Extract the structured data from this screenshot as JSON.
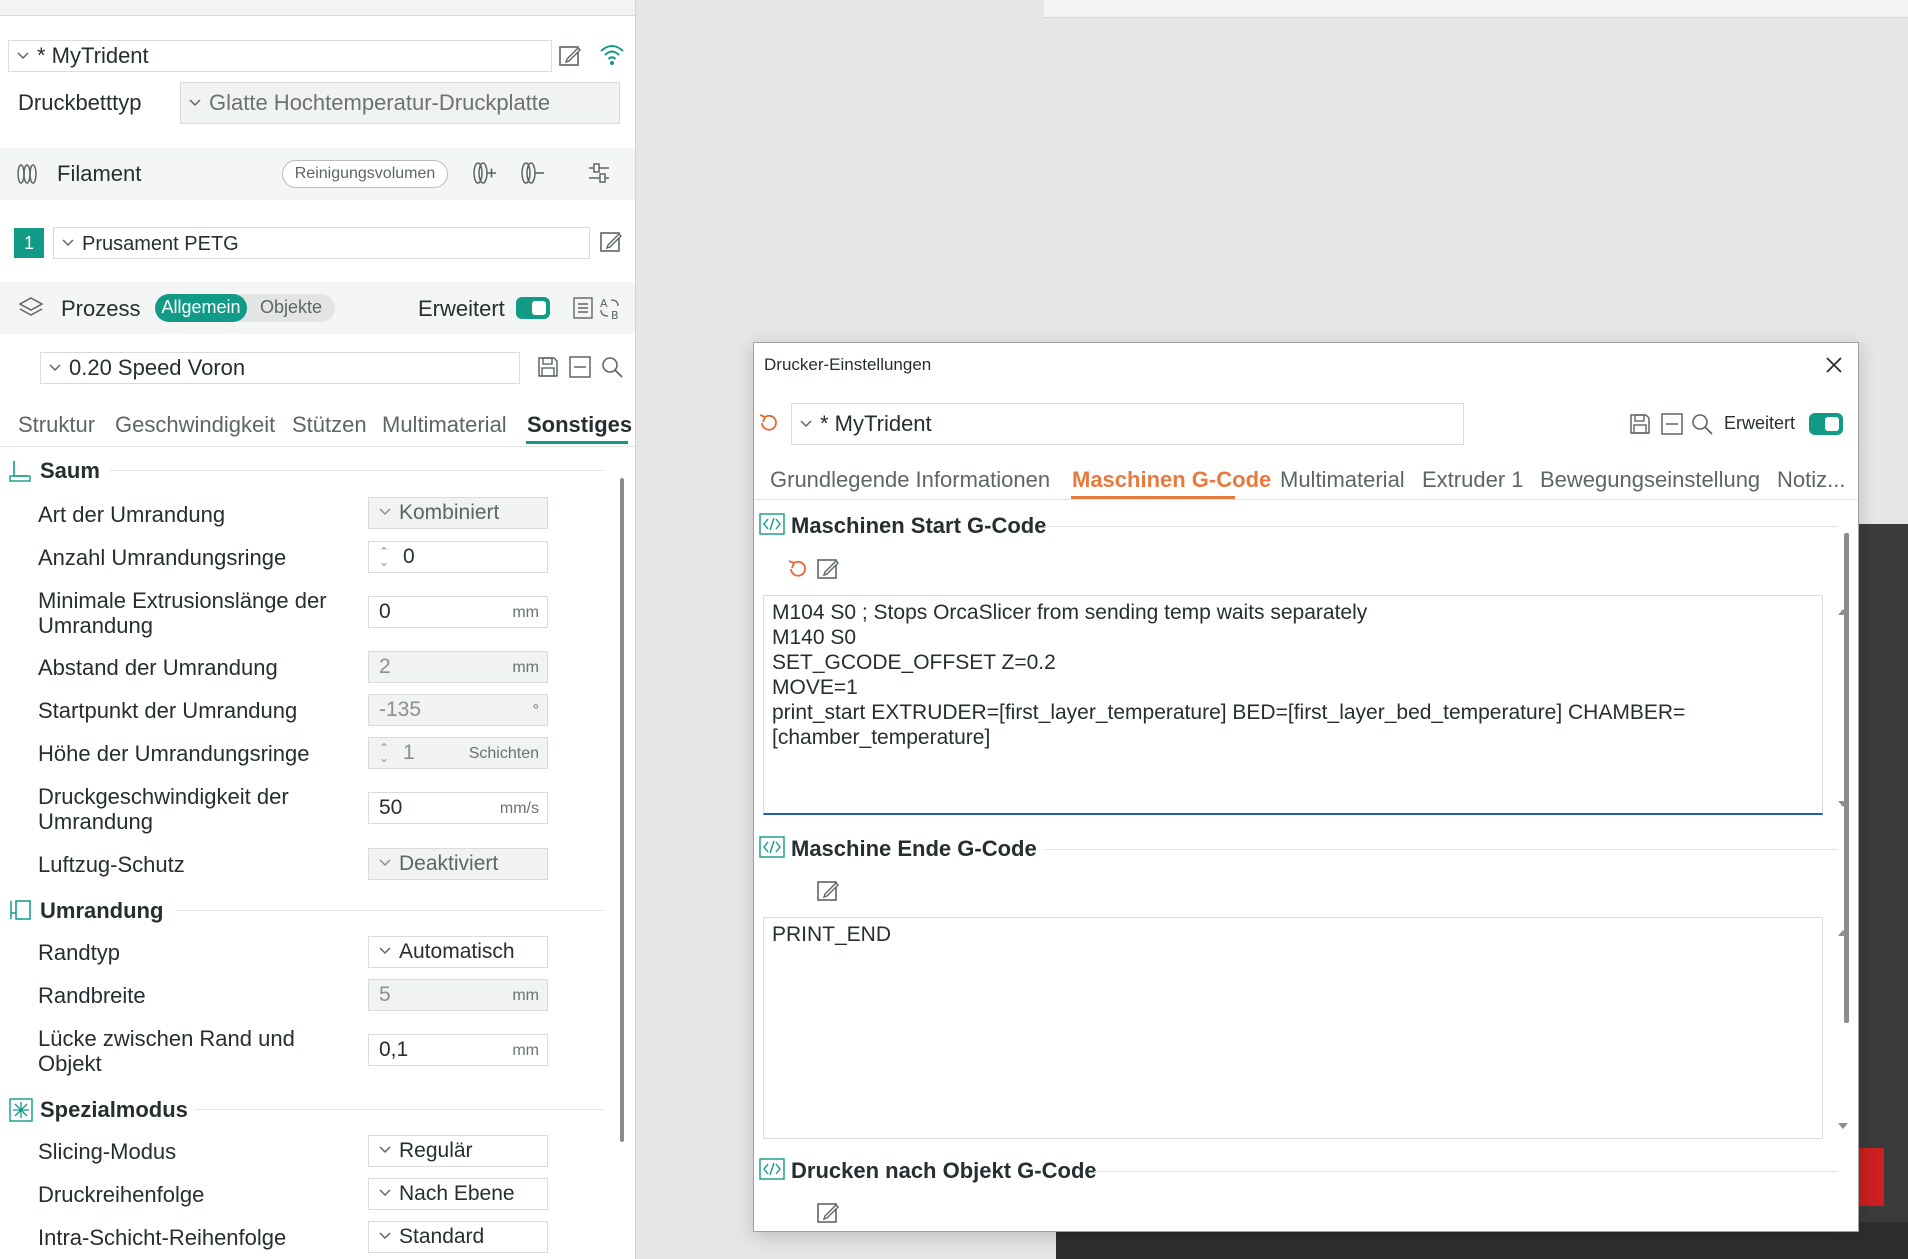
{
  "printer": {
    "name": "* MyTrident"
  },
  "bed": {
    "label": "Druckbetttyp",
    "value": "Glatte Hochtemperatur-Druckplatte"
  },
  "filament": {
    "title": "Filament",
    "purge_button": "Reinigungsvolumen",
    "slot_number": "1",
    "selected": "Prusament PETG"
  },
  "process": {
    "title": "Prozess",
    "mode_general": "Allgemein",
    "mode_objects": "Objekte",
    "advanced_label": "Erweitert",
    "profile": "0.20 Speed Voron",
    "tabs": [
      "Struktur",
      "Geschwindigkeit",
      "Stützen",
      "Multimaterial",
      "Sonstiges"
    ],
    "active_tab": "Sonstiges"
  },
  "groups": {
    "saum": {
      "title": "Saum",
      "rows": [
        {
          "label": "Art der Umrandung",
          "value": "Kombiniert",
          "unit": ""
        },
        {
          "label": "Anzahl Umrandungsringe",
          "value": "0",
          "unit": ""
        },
        {
          "label": "Minimale Extrusionslänge der Umrandung",
          "value": "0",
          "unit": "mm"
        },
        {
          "label": "Abstand der Umrandung",
          "value": "2",
          "unit": "mm"
        },
        {
          "label": "Startpunkt der Umrandung",
          "value": "-135",
          "unit": "°"
        },
        {
          "label": "Höhe der Umrandungsringe",
          "value": "1",
          "unit": "Schichten"
        },
        {
          "label": "Druckgeschwindigkeit der Umrandung",
          "value": "50",
          "unit": "mm/s"
        },
        {
          "label": "Luftzug-Schutz",
          "value": "Deaktiviert",
          "unit": ""
        }
      ]
    },
    "umrandung": {
      "title": "Umrandung",
      "rows": [
        {
          "label": "Randtyp",
          "value": "Automatisch",
          "unit": ""
        },
        {
          "label": "Randbreite",
          "value": "5",
          "unit": "mm"
        },
        {
          "label": "Lücke zwischen Rand und Objekt",
          "value": "0,1",
          "unit": "mm"
        }
      ]
    },
    "spezial": {
      "title": "Spezialmodus",
      "rows": [
        {
          "label": "Slicing-Modus",
          "value": "Regulär",
          "unit": ""
        },
        {
          "label": "Druckreihenfolge",
          "value": "Nach Ebene",
          "unit": ""
        },
        {
          "label": "Intra-Schicht-Reihenfolge",
          "value": "Standard",
          "unit": ""
        }
      ]
    }
  },
  "dialog": {
    "title": "Drucker-Einstellungen",
    "printer": "* MyTrident",
    "advanced_label": "Erweitert",
    "tabs": [
      "Grundlegende Informationen",
      "Maschinen G-Code",
      "Multimaterial",
      "Extruder 1",
      "Bewegungseinstellung",
      "Notiz..."
    ],
    "active_tab": "Maschinen G-Code",
    "start_gcode": {
      "title": "Maschinen Start G-Code",
      "code": "M104 S0 ; Stops OrcaSlicer from sending temp waits separately\nM140 S0\nSET_GCODE_OFFSET Z=0.2\nMOVE=1\nprint_start EXTRUDER=[first_layer_temperature] BED=[first_layer_bed_temperature] CHAMBER=\n[chamber_temperature]"
    },
    "end_gcode": {
      "title": "Maschine Ende G-Code",
      "code": "PRINT_END"
    },
    "by_object_gcode": {
      "title": "Drucken nach Objekt G-Code"
    }
  },
  "colors": {
    "accent": "#119a86",
    "tab_active_dialog": "#e87a3e",
    "undo": "#e8672e"
  }
}
